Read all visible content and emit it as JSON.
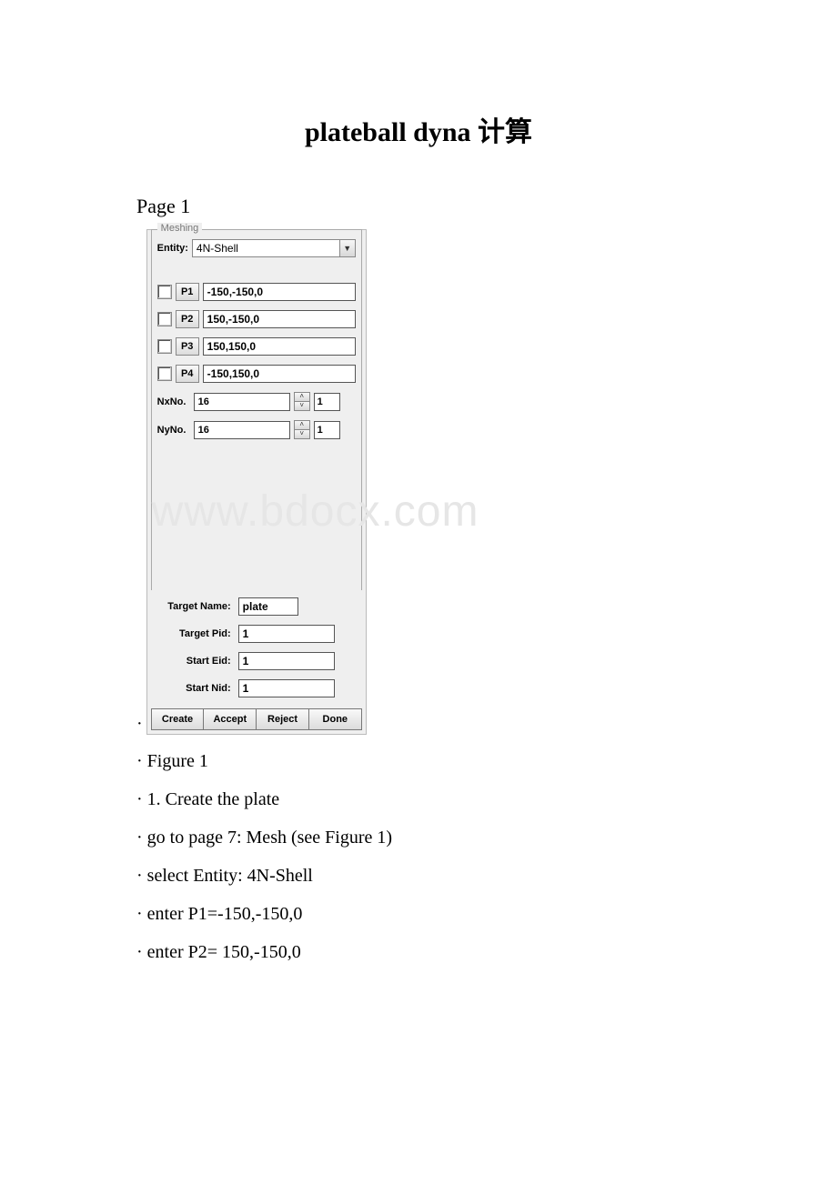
{
  "title": "plateball dyna 计算",
  "page_label": "Page 1",
  "watermark": "www.bdocx.com",
  "panel": {
    "fieldset_label": "Meshing",
    "entity_label": "Entity:",
    "entity_value": "4N-Shell",
    "points": [
      {
        "name": "P1",
        "value": "-150,-150,0"
      },
      {
        "name": "P2",
        "value": "150,-150,0"
      },
      {
        "name": "P3",
        "value": "150,150,0"
      },
      {
        "name": "P4",
        "value": "-150,150,0"
      }
    ],
    "nx_label": "NxNo.",
    "nx_value": "16",
    "nx_small": "1",
    "ny_label": "NyNo.",
    "ny_value": "16",
    "ny_small": "1",
    "target_name_label": "Target Name:",
    "target_name_value": "plate",
    "target_pid_label": "Target Pid:",
    "target_pid_value": "1",
    "start_eid_label": "Start Eid:",
    "start_eid_value": "1",
    "start_nid_label": "Start Nid:",
    "start_nid_value": "1",
    "buttons": {
      "create": "Create",
      "accept": "Accept",
      "reject": "Reject",
      "done": "Done"
    }
  },
  "dot": "·",
  "text_lines": [
    "· Figure 1",
    "· 1. Create the plate",
    "· go to page 7: Mesh (see Figure 1)",
    "· select Entity: 4N-Shell",
    "· enter P1=-150,-150,0",
    "· enter P2= 150,-150,0"
  ]
}
